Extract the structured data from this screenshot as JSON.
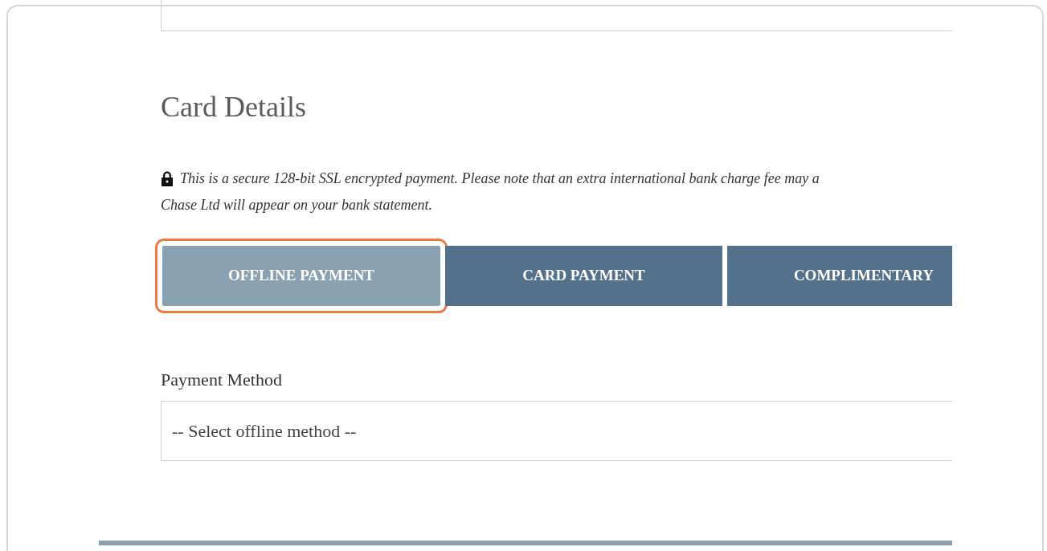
{
  "section": {
    "title": "Card Details"
  },
  "notice": {
    "lines": [
      "This is a secure 128-bit SSL encrypted payment. Please note that an extra international bank charge fee may a",
      "Chase Ltd will appear on your bank statement."
    ]
  },
  "payment_tabs": [
    {
      "label": "OFFLINE PAYMENT",
      "selected": true
    },
    {
      "label": "CARD PAYMENT",
      "selected": false
    },
    {
      "label": "COMPLIMENTARY",
      "selected": false
    }
  ],
  "payment_method": {
    "label": "Payment Method",
    "value": "-- Select offline method --"
  }
}
